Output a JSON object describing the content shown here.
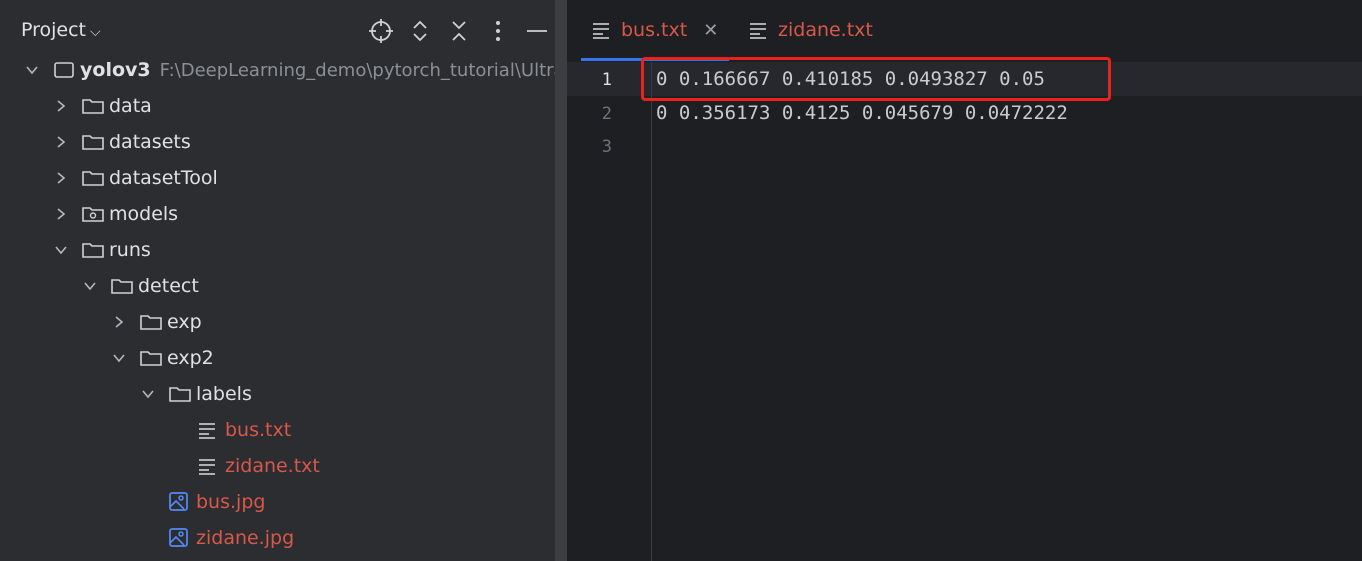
{
  "project_panel": {
    "title": "Project",
    "tree": [
      {
        "label": "yolov3",
        "path": "F:\\DeepLearning_demo\\pytorch_tutorial\\Ultra"
      },
      {
        "label": "data"
      },
      {
        "label": "datasets"
      },
      {
        "label": "datasetTool"
      },
      {
        "label": "models"
      },
      {
        "label": "runs"
      },
      {
        "label": "detect"
      },
      {
        "label": "exp"
      },
      {
        "label": "exp2"
      },
      {
        "label": "labels"
      },
      {
        "label": "bus.txt"
      },
      {
        "label": "zidane.txt"
      },
      {
        "label": "bus.jpg"
      },
      {
        "label": "zidane.jpg"
      }
    ]
  },
  "editor": {
    "tabs": [
      {
        "label": "bus.txt"
      },
      {
        "label": "zidane.txt"
      }
    ],
    "lines": [
      {
        "num": "1",
        "text": "0 0.166667 0.410185 0.0493827 0.05"
      },
      {
        "num": "2",
        "text": "0 0.356173 0.4125 0.045679 0.0472222"
      },
      {
        "num": "3",
        "text": ""
      }
    ]
  },
  "colors": {
    "modified_file": "#d8584a",
    "highlight_box": "#e8231a",
    "image_icon": "#548af7"
  }
}
